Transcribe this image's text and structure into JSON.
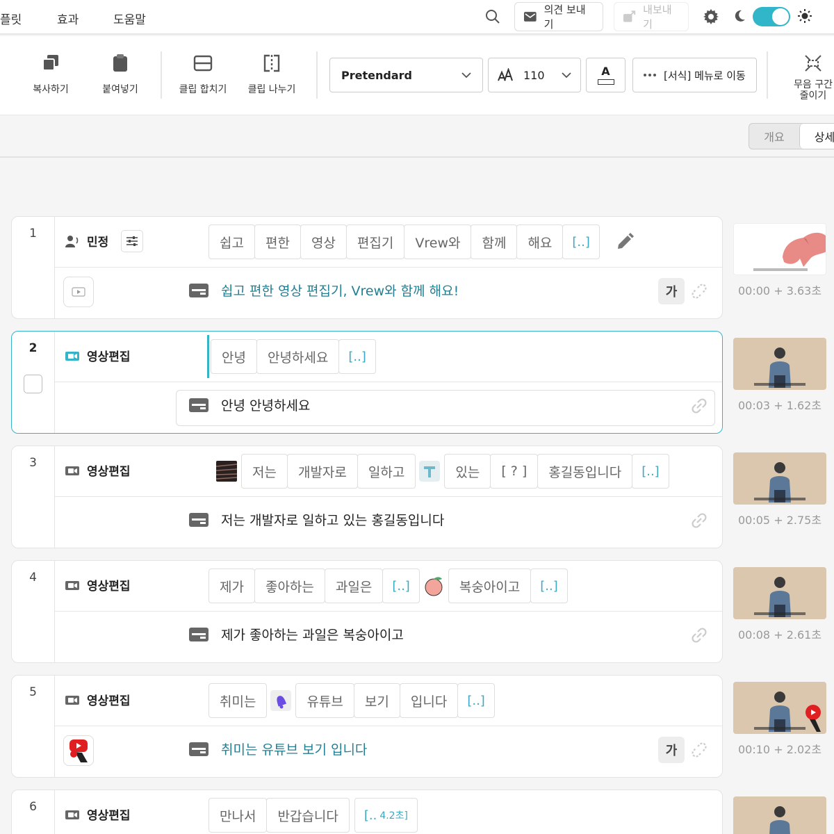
{
  "menu": {
    "items": [
      "플릿",
      "효과",
      "도움말"
    ]
  },
  "header": {
    "feedback_label": "의견 보내기",
    "export_label": "내보내기"
  },
  "toolbar": {
    "copy_label": "복사하기",
    "paste_label": "붙여넣기",
    "merge_label": "클립 합치기",
    "split_label": "클립 나누기",
    "font_family": "Pretendard",
    "font_size": "110",
    "color_glyph": "A",
    "format_label": "[서식] 메뉴로 이동",
    "silence_line1": "무음 구간",
    "silence_line2": "줄이기"
  },
  "view_tabs": {
    "overview": "개요",
    "detail": "상세"
  },
  "clips": [
    {
      "number": "1",
      "speaker": "민정",
      "words": [
        "쉽고",
        "편한",
        "영상",
        "편집기",
        "Vrew와",
        "함께",
        "해요"
      ],
      "gap": "[..]",
      "subtitle": "쉽고 편한 영상 편집기, Vrew와 함께 해요!",
      "ga": "가",
      "time": "00:00 + 3.63초"
    },
    {
      "number": "2",
      "speaker": "영상편집",
      "words": [
        "안녕",
        "안녕하세요"
      ],
      "gap": "[..]",
      "subtitle": "안녕 안녕하세요",
      "time": "00:03 + 1.62초"
    },
    {
      "number": "3",
      "speaker": "영상편집",
      "words": [
        "저는",
        "개발자로",
        "일하고",
        "있는",
        "[ ? ]",
        "홍길동입니다"
      ],
      "gap": "[..]",
      "subtitle": "저는 개발자로 일하고 있는 홍길동입니다",
      "time": "00:05 + 2.75초"
    },
    {
      "number": "4",
      "speaker": "영상편집",
      "words": [
        "제가",
        "좋아하는",
        "과일은",
        "복숭아이고"
      ],
      "gap": "[..]",
      "subtitle": "제가 좋아하는 과일은 복숭아이고",
      "time": "00:08 + 2.61초"
    },
    {
      "number": "5",
      "speaker": "영상편집",
      "words": [
        "취미는",
        "유튜브",
        "보기",
        "입니다"
      ],
      "gap": "[..]",
      "subtitle": "취미는 유튜브 보기 입니다",
      "ga": "가",
      "time": "00:10 + 2.02초"
    },
    {
      "number": "6",
      "speaker": "영상편집",
      "words": [
        "만나서",
        "반갑습니다"
      ],
      "gap": "[..",
      "gap_duration": "4.2초]"
    }
  ],
  "colors": {
    "accent": "#35b3c8",
    "subtitle_teal": "#217f94",
    "gap_blue": "#3ba9c0"
  },
  "icons": [
    "search-icon",
    "mail-icon",
    "export-icon",
    "gear-icon",
    "moon-icon",
    "sun-icon",
    "copy-icon",
    "paste-icon",
    "merge-icon",
    "split-icon",
    "speaker-person-icon",
    "camera-icon",
    "sliders-icon",
    "pencil-icon",
    "subtitle-icon",
    "link-icon",
    "chevron-down-icon",
    "more-icon"
  ]
}
